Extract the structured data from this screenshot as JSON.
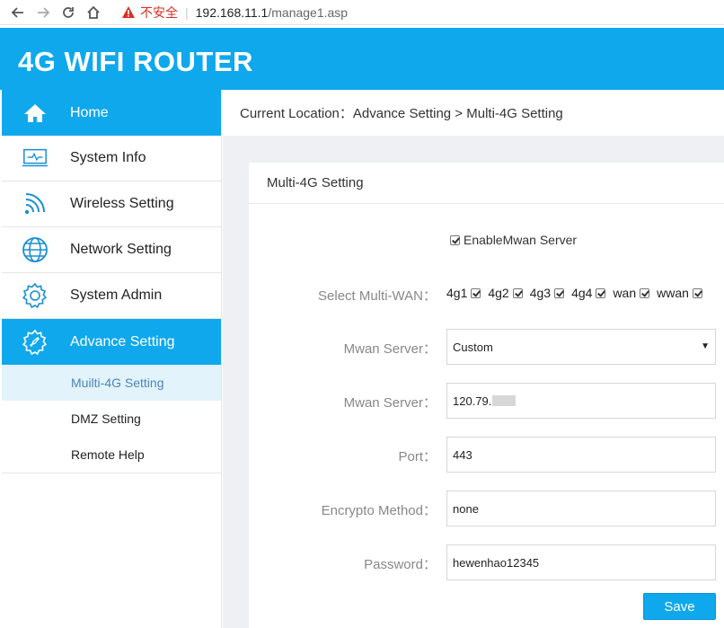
{
  "browser": {
    "security_warning": "不安全",
    "url_host": "192.168.11.1",
    "url_path": "/manage1.asp"
  },
  "brand": {
    "title": "4G WIFI ROUTER"
  },
  "sidebar": {
    "items": [
      {
        "label": "Home",
        "icon": "home-icon"
      },
      {
        "label": "System Info",
        "icon": "monitor-icon"
      },
      {
        "label": "Wireless Setting",
        "icon": "wireless-icon"
      },
      {
        "label": "Network Setting",
        "icon": "globe-icon"
      },
      {
        "label": "System Admin",
        "icon": "gear-icon"
      },
      {
        "label": "Advance Setting",
        "icon": "rocket-icon"
      }
    ],
    "sub_items": [
      {
        "label": "Muilti-4G Setting"
      },
      {
        "label": "DMZ Setting"
      },
      {
        "label": "Remote Help"
      }
    ],
    "active_item": "Advance Setting",
    "active_sub_item": "Muilti-4G Setting"
  },
  "breadcrumb": {
    "text": "Current Location：Advance Setting > Multi-4G Setting"
  },
  "panel": {
    "title": "Multi-4G Setting",
    "enable_label": "EnableMwan Server",
    "enable_checked": true,
    "select_wan_label": "Select Multi-WAN：",
    "wan_options": [
      {
        "label": "4g1",
        "checked": true
      },
      {
        "label": "4g2",
        "checked": true
      },
      {
        "label": "4g3",
        "checked": true
      },
      {
        "label": "4g4",
        "checked": true
      },
      {
        "label": "wan",
        "checked": true
      },
      {
        "label": "wwan",
        "checked": true
      }
    ],
    "mwan_server_select_label": "Mwan Server：",
    "mwan_server_select_value": "Custom",
    "mwan_server_input_label": "Mwan Server：",
    "mwan_server_input_value": "120.79.",
    "port_label": "Port：",
    "port_value": "443",
    "encrypt_label": "Encrypto Method：",
    "encrypt_value": "none",
    "password_label": "Password：",
    "password_value": "hewenhao12345",
    "save_label": "Save"
  },
  "colors": {
    "accent": "#0fa8ec",
    "active_sub_bg": "#e3f3fb",
    "warning": "#d93025"
  }
}
